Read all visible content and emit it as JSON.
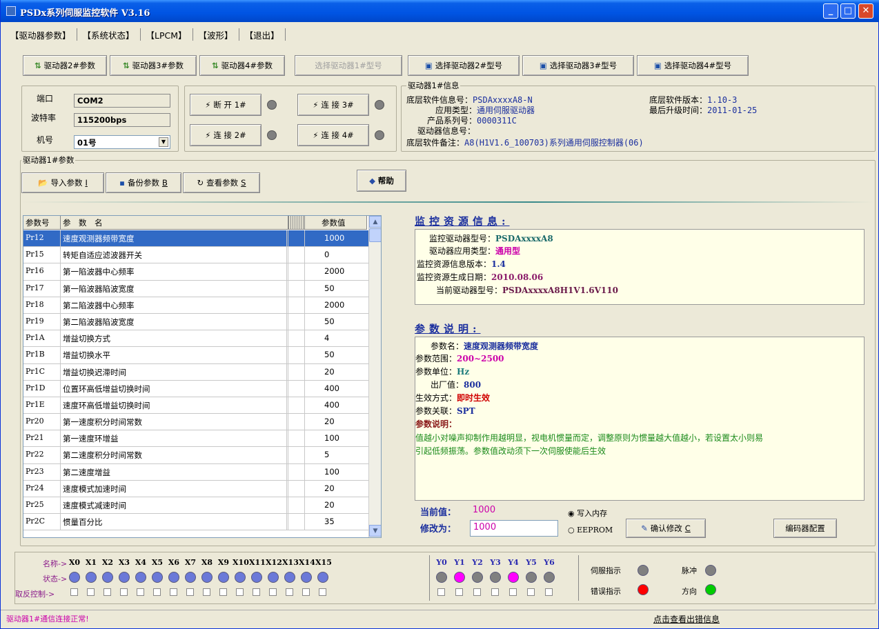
{
  "window": {
    "title": "PSDx系列伺服监控软件 V3.16"
  },
  "menu": [
    "【驱动器参数】",
    "【系统状态】",
    "【LPCM】",
    "【波形】",
    "【退出】"
  ],
  "toolbar": {
    "drv2": "驱动器2#参数",
    "drv3": "驱动器3#参数",
    "drv4": "驱动器4#参数",
    "sel1": "选择驱动器1#型号",
    "sel2": "选择驱动器2#型号",
    "sel3": "选择驱动器3#型号",
    "sel4": "选择驱动器4#型号"
  },
  "conn": {
    "port_label": "端口",
    "port": "COM2",
    "baud_label": "波特率",
    "baud": "115200bps",
    "id_label": "机号",
    "id": "01号",
    "b1": "断 开 1#",
    "b2": "连 接 2#",
    "b3": "连 接 3#",
    "b4": "连 接 4#"
  },
  "drvinfo": {
    "legend": "驱动器1#信息",
    "sw_label": "底层软件信息号：",
    "sw": "PSDAxxxxA8-N",
    "app_label": "应用类型：",
    "app": "通用伺服驱动器",
    "serial_label": "产品系列号：",
    "serial": "0000311C",
    "drvinfo_label": "驱动器信息号：",
    "remark_label": "底层软件备注：",
    "remark": "A8(H1V1.6_100703)系列通用伺服控制器(06)",
    "ver_label": "底层软件版本：",
    "ver": "1.10-3",
    "upd_label": "最后升级时间：",
    "upd": "2011-01-25"
  },
  "params": {
    "legend": "驱动器1#参数",
    "import": "导入参数",
    "import_key": "I",
    "backup": "备份参数",
    "backup_key": "B",
    "view": "查看参数",
    "view_key": "S",
    "help": "帮助"
  },
  "table": {
    "headers": [
      "参数号",
      "参　数　名",
      "",
      "参数值"
    ],
    "rows": [
      [
        "Pr12",
        "速度观测器频带宽度",
        "1000"
      ],
      [
        "Pr15",
        "转矩自适应滤波器开关",
        "0"
      ],
      [
        "Pr16",
        "第一陷波器中心频率",
        "2000"
      ],
      [
        "Pr17",
        "第一陷波器陷波宽度",
        "50"
      ],
      [
        "Pr18",
        "第二陷波器中心频率",
        "2000"
      ],
      [
        "Pr19",
        "第二陷波器陷波宽度",
        "50"
      ],
      [
        "Pr1A",
        "增益切换方式",
        "4"
      ],
      [
        "Pr1B",
        "增益切换水平",
        "50"
      ],
      [
        "Pr1C",
        "增益切换迟滞时间",
        "20"
      ],
      [
        "Pr1D",
        "位置环高低增益切换时间",
        "400"
      ],
      [
        "Pr1E",
        "速度环高低增益切换时间",
        "400"
      ],
      [
        "Pr20",
        "第一速度积分时间常数",
        "20"
      ],
      [
        "Pr21",
        "第一速度环增益",
        "100"
      ],
      [
        "Pr22",
        "第二速度积分时间常数",
        "5"
      ],
      [
        "Pr23",
        "第二速度增益",
        "100"
      ],
      [
        "Pr24",
        "速度模式加速时间",
        "20"
      ],
      [
        "Pr25",
        "速度模式减速时间",
        "20"
      ],
      [
        "Pr2C",
        "惯量百分比",
        "35"
      ]
    ]
  },
  "monitor": {
    "title": "监控资源信息:",
    "model_label": "监控驱动器型号：",
    "model": "PSDAxxxxA8",
    "type_label": "驱动器应用类型：",
    "type": "通用型",
    "ver_label": "监控资源信息版本：",
    "ver": "1.4",
    "date_label": "监控资源生成日期：",
    "date": "2010.08.06",
    "cur_label": "当前驱动器型号：",
    "cur": "PSDAxxxxA8H1V1.6V110"
  },
  "desc": {
    "title": "参数说明:",
    "name_label": "参数名：",
    "name": "速度观测器频带宽度",
    "range_label": "参数范围：",
    "range": "200~2500",
    "unit_label": "参数单位：",
    "unit": "Hz",
    "def_label": "出厂值：",
    "def": "800",
    "eff_label": "生效方式：",
    "eff": "即时生效",
    "rel_label": "参数关联：",
    "rel": "SPT",
    "expl_label": "参数说明：",
    "expl1": "值越小对噪声抑制作用越明显，视电机惯量而定，调整原则为惯量越大值越小，若设置太小则易",
    "expl2": "引起低频振荡。参数值改动须下一次伺服使能后生效"
  },
  "edit": {
    "cur_label": "当前值：",
    "cur": "1000",
    "mod_label": "修改为：",
    "mod": "1000",
    "opt1": "写入内存",
    "opt2": "EEPROM",
    "confirm": "确认修改",
    "confirm_key": "C",
    "encoder": "编码器配置"
  },
  "io": {
    "name_label": "名称->",
    "state_label": "状态->",
    "inv_label": "取反控制->",
    "x": [
      "X0",
      "X1",
      "X2",
      "X3",
      "X4",
      "X5",
      "X6",
      "X7",
      "X8",
      "X9",
      "X10",
      "X11",
      "X12",
      "X13",
      "X14",
      "X15"
    ],
    "y": [
      "Y0",
      "Y1",
      "Y2",
      "Y3",
      "Y4",
      "Y5",
      "Y6"
    ],
    "y_state": [
      "off",
      "on",
      "off",
      "off",
      "on",
      "off",
      "off"
    ],
    "servo": "伺服指示",
    "pulse": "脉冲",
    "error": "错误指示",
    "dir": "方向"
  },
  "colors": {
    "x_led": "#6b79d8",
    "y_on": "#ff00ff",
    "y_off": "#808080",
    "err": "#ff0000",
    "dir": "#00cc00"
  },
  "status": {
    "msg": "驱动器1#通信连接正常!",
    "link": "点击查看出错信息"
  }
}
